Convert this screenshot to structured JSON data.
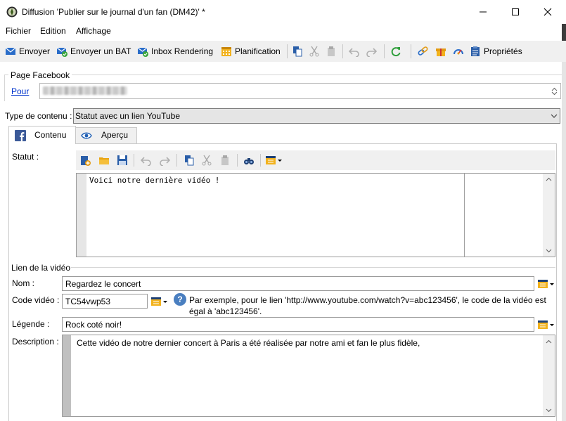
{
  "window": {
    "title": "Diffusion 'Publier sur le journal d'un fan (DM42)' *"
  },
  "menu": {
    "items": [
      "Fichier",
      "Edition",
      "Affichage"
    ]
  },
  "toolbar": {
    "send": "Envoyer",
    "send_proof": "Envoyer un BAT",
    "inbox_rendering": "Inbox Rendering",
    "schedule": "Planification",
    "properties": "Propriétés"
  },
  "facebook_page": {
    "legend": "Page Facebook",
    "for_link": "Pour"
  },
  "content_type": {
    "label": "Type de contenu :",
    "value": "Statut avec un lien YouTube"
  },
  "tabs": [
    {
      "label": "Contenu",
      "active": true
    },
    {
      "label": "Aperçu",
      "active": false
    }
  ],
  "status": {
    "label": "Statut :",
    "text": "Voici notre dernière vidéo !"
  },
  "video": {
    "legend": "Lien de la vidéo",
    "name_label": "Nom :",
    "name_value": "Regardez le concert",
    "code_label": "Code vidéo :",
    "code_value": "TC54vwp53",
    "help_text": "Par exemple, pour le lien 'http://www.youtube.com/watch?v=abc123456', le code de la vidéo est égal à 'abc123456'.",
    "caption_label": "Légende :",
    "caption_value": "Rock coté noir!",
    "description_label": "Description :",
    "description_value": "Cette vidéo de notre dernier concert à Paris a été réalisée par notre ami et fan le plus fidèle,"
  },
  "colors": {
    "link": "#0033cc",
    "facebook": "#3b5998",
    "accent_blue": "#1f5fb4"
  }
}
